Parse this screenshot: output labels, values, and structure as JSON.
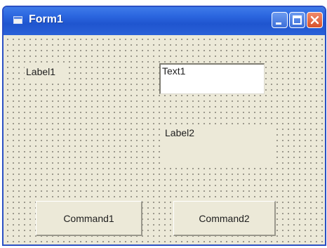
{
  "window": {
    "title": "Form1"
  },
  "controls": {
    "label1": "Label1",
    "text1": "Text1",
    "label2": "Label2",
    "command1": "Command1",
    "command2": "Command2"
  },
  "colors": {
    "titlebar": "#2c67e0",
    "form_background": "#ece9d8",
    "close_button": "#d8512a"
  },
  "icons": {
    "form": "form-icon",
    "minimize": "minimize-icon",
    "maximize": "maximize-icon",
    "close": "close-icon"
  }
}
